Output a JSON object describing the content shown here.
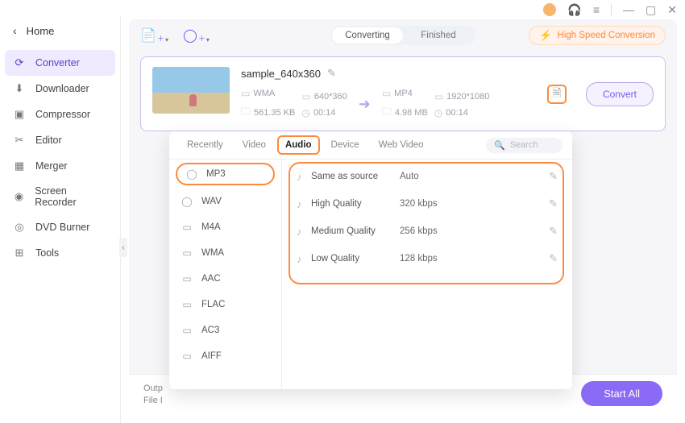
{
  "titlebar": {
    "user_icon": "user",
    "help_icon": "headset",
    "menu_icon": "≡",
    "min": "—",
    "max": "▢",
    "close": "✕"
  },
  "sidebar": {
    "home": "Home",
    "items": [
      {
        "icon": "⟳",
        "label": "Converter",
        "active": true
      },
      {
        "icon": "⬇",
        "label": "Downloader"
      },
      {
        "icon": "▣",
        "label": "Compressor"
      },
      {
        "icon": "✂",
        "label": "Editor"
      },
      {
        "icon": "▦",
        "label": "Merger"
      },
      {
        "icon": "◉",
        "label": "Screen Recorder"
      },
      {
        "icon": "◎",
        "label": "DVD Burner"
      },
      {
        "icon": "⊞",
        "label": "Tools"
      }
    ]
  },
  "toolbar": {
    "seg": {
      "converting": "Converting",
      "finished": "Finished"
    },
    "hsc": "High Speed Conversion"
  },
  "file": {
    "name": "sample_640x360",
    "src": {
      "fmt": "WMA",
      "res": "640*360",
      "size": "561.35 KB",
      "dur": "00:14"
    },
    "dst": {
      "fmt": "MP4",
      "res": "1920*1080",
      "size": "4.98 MB",
      "dur": "00:14"
    },
    "convert": "Convert"
  },
  "dropdown": {
    "tabs": [
      "Recently",
      "Video",
      "Audio",
      "Device",
      "Web Video"
    ],
    "active_tab": "Audio",
    "search_placeholder": "Search",
    "formats": [
      "MP3",
      "WAV",
      "M4A",
      "WMA",
      "AAC",
      "FLAC",
      "AC3",
      "AIFF"
    ],
    "selected_format": "MP3",
    "qualities": [
      {
        "name": "Same as source",
        "value": "Auto"
      },
      {
        "name": "High Quality",
        "value": "320 kbps"
      },
      {
        "name": "Medium Quality",
        "value": "256 kbps"
      },
      {
        "name": "Low Quality",
        "value": "128 kbps"
      }
    ]
  },
  "footer": {
    "output_label": "Outp",
    "file_label": "File I",
    "start_all": "Start All"
  }
}
